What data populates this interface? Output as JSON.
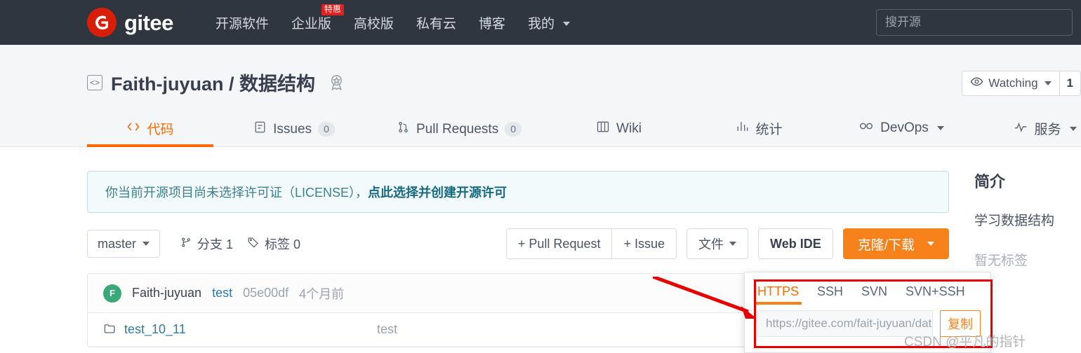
{
  "topnav": {
    "brand": "gitee",
    "brand_icon": "gitee-logo-icon",
    "links": [
      {
        "label": "开源软件",
        "caret": false,
        "badge": null
      },
      {
        "label": "企业版",
        "caret": false,
        "badge": "特惠"
      },
      {
        "label": "高校版",
        "caret": false,
        "badge": null
      },
      {
        "label": "私有云",
        "caret": false,
        "badge": null
      },
      {
        "label": "博客",
        "caret": false,
        "badge": null
      },
      {
        "label": "我的",
        "caret": true,
        "badge": null
      }
    ],
    "search_placeholder": "搜开源"
  },
  "repo": {
    "owner": "Faith-juyuan",
    "separator": "/",
    "name": "数据结构",
    "full_title": "Faith-juyuan / 数据结构",
    "repo_icon": "code-brackets-icon",
    "badge_icon": "award-medal-icon",
    "watch": {
      "label": "Watching",
      "icon": "eye-icon",
      "count": "1"
    }
  },
  "tabs": [
    {
      "label": "代码",
      "icon": "code-icon",
      "count": null,
      "active": true,
      "caret": false
    },
    {
      "label": "Issues",
      "icon": "issues-icon",
      "count": "0",
      "active": false,
      "caret": false
    },
    {
      "label": "Pull Requests",
      "icon": "pull-request-icon",
      "count": "0",
      "active": false,
      "caret": false
    },
    {
      "label": "Wiki",
      "icon": "book-icon",
      "count": null,
      "active": false,
      "caret": false
    },
    {
      "label": "统计",
      "icon": "chart-bar-icon",
      "count": null,
      "active": false,
      "caret": false
    },
    {
      "label": "DevOps",
      "icon": "infinity-icon",
      "count": null,
      "active": false,
      "caret": true
    },
    {
      "label": "服务",
      "icon": "pulse-icon",
      "count": null,
      "active": false,
      "caret": true
    }
  ],
  "license_banner": {
    "text": "你当前开源项目尚未选择许可证（LICENSE），",
    "link": "点此选择并创建开源许可"
  },
  "toolbar": {
    "branch": "master",
    "branches": {
      "label": "分支 1",
      "icon": "branch-icon"
    },
    "tags": {
      "label": "标签 0",
      "icon": "tag-icon"
    },
    "pull_request_btn": "+ Pull Request",
    "issue_btn": "+ Issue",
    "files_btn": "文件",
    "web_ide_btn": "Web IDE",
    "clone_btn": "克隆/下载"
  },
  "commit": {
    "avatar_letter": "F",
    "author": "Faith-juyuan",
    "message": "test",
    "sha": "05e00df",
    "time": "4个月前"
  },
  "files": [
    {
      "icon": "folder-icon",
      "name": "test_10_11",
      "commit": "test"
    }
  ],
  "sidebar": {
    "title": "简介",
    "description": "学习数据结构",
    "tags": "暂无标签"
  },
  "clone_popover": {
    "tabs": [
      "HTTPS",
      "SSH",
      "SVN",
      "SVN+SSH"
    ],
    "active_tab": "HTTPS",
    "url": "https://gitee.com/fait-juyuan/data-stru",
    "copy_label": "复制"
  },
  "watermark": "CSDN @平凡的指针",
  "colors": {
    "navbar_bg": "#2f3640",
    "accent_orange": "#ff6a00",
    "button_orange": "#f7821b",
    "logo_red": "#d81e06",
    "annotation_red": "#e60000",
    "avatar_green": "#3aa877",
    "link_blue": "#2d7d9a",
    "banner_teal": "#3b7f90"
  }
}
